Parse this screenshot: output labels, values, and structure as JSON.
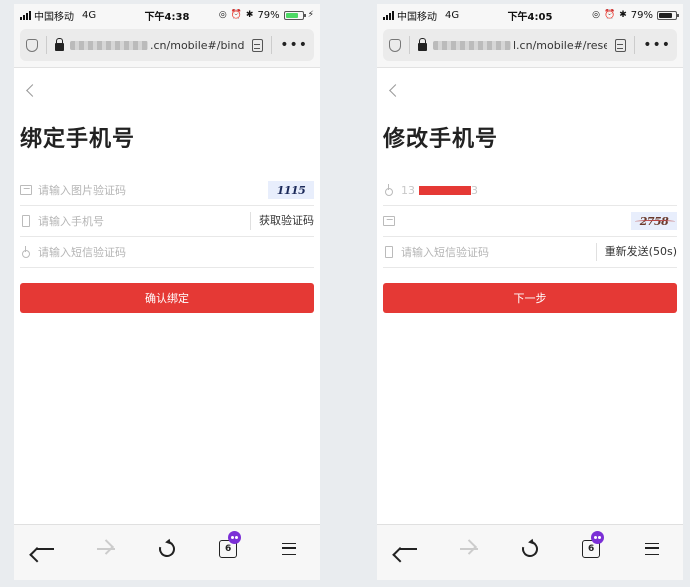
{
  "colors": {
    "accent": "#e53935",
    "battery_fill": "#4cd964",
    "battery_fill_dark": "#222222",
    "private_badge": "#7b2fd6"
  },
  "phones": [
    {
      "status": {
        "carrier": "中国移动",
        "network": "4G",
        "time": "下午4:38",
        "battery": "79%",
        "battery_level": 0.79,
        "charging": true
      },
      "url": {
        "visible_text": ".cn/mobile#/bind..."
      },
      "page": {
        "title": "绑定手机号",
        "captcha_placeholder": "请输入图片验证码",
        "captcha_text": "1115",
        "phone_placeholder": "请输入手机号",
        "get_code_label": "获取验证码",
        "sms_placeholder": "请输入短信验证码",
        "submit_label": "确认绑定"
      },
      "toolbar": {
        "tab_count": "6"
      }
    },
    {
      "status": {
        "carrier": "中国移动",
        "network": "4G",
        "time": "下午4:05",
        "battery": "79%",
        "battery_level": 0.79,
        "charging": false
      },
      "url": {
        "visible_text": "l.cn/mobile#/rese..."
      },
      "page": {
        "title": "修改手机号",
        "phone_prefix": "13",
        "phone_suffix": "3",
        "captcha_text": "2758",
        "sms_placeholder": "请输入短信验证码",
        "resend_label": "重新发送(50s)",
        "submit_label": "下一步"
      },
      "toolbar": {
        "tab_count": "6"
      }
    }
  ]
}
